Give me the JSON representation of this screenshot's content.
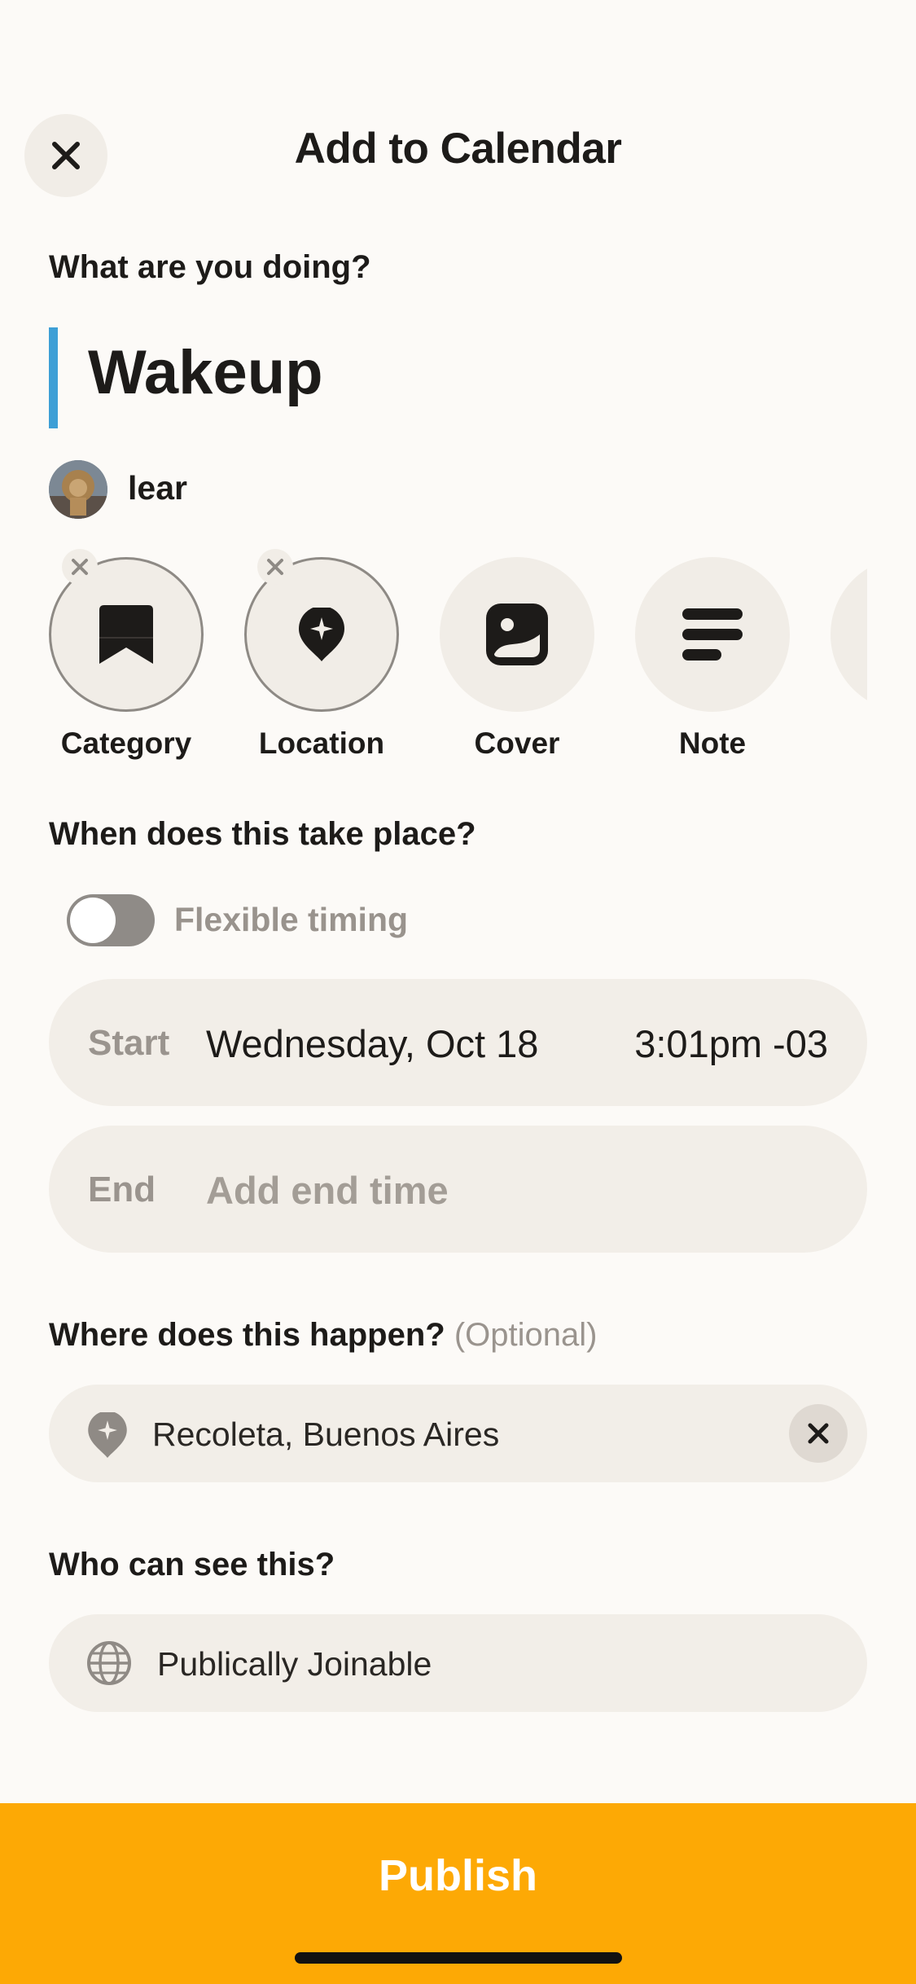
{
  "header": {
    "title": "Add to Calendar"
  },
  "what": {
    "question": "What are you doing?",
    "event_name": "Wakeup",
    "accent_color": "#3d9fd6",
    "user": {
      "name": "lear"
    }
  },
  "attachments": [
    {
      "label": "Category",
      "icon": "bookmark-icon",
      "selected": true
    },
    {
      "label": "Location",
      "icon": "location-pin-icon",
      "selected": true
    },
    {
      "label": "Cover",
      "icon": "image-icon",
      "selected": false
    },
    {
      "label": "Note",
      "icon": "note-lines-icon",
      "selected": false
    }
  ],
  "when": {
    "question": "When does this take place?",
    "flexible_label": "Flexible timing",
    "flexible_on": false,
    "start_label": "Start",
    "start_date": "Wednesday, Oct 18",
    "start_time": "3:01pm -03",
    "end_label": "End",
    "end_placeholder": "Add end time"
  },
  "where": {
    "question": "Where does this happen?",
    "optional": "(Optional)",
    "location": "Recoleta, Buenos Aires"
  },
  "who": {
    "question": "Who can see this?",
    "visibility": "Publically Joinable"
  },
  "footer": {
    "publish_label": "Publish",
    "accent": "#fda905"
  }
}
